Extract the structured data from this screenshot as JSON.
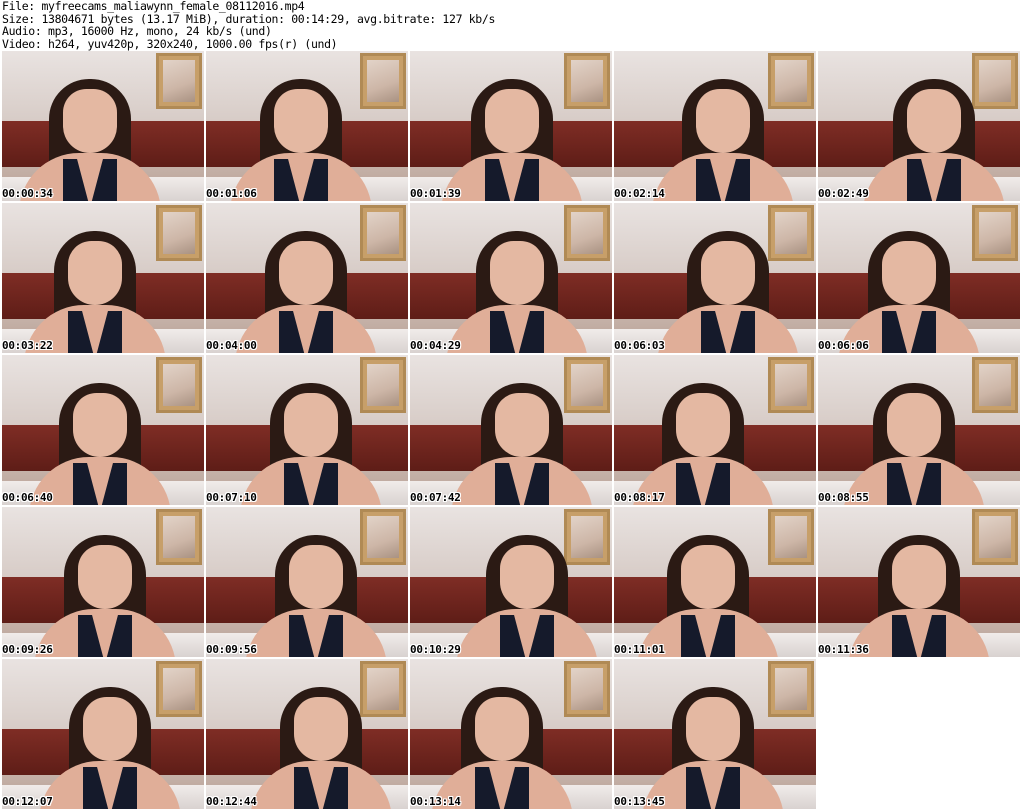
{
  "header": {
    "file_line": "File: myfreecams_maliawynn_female_08112016.mp4",
    "size_line": "Size: 13804671 bytes (13.17 MiB), duration: 00:14:29, avg.bitrate: 127 kb/s",
    "audio_line": "Audio: mp3, 16000 Hz, mono, 24 kb/s (und)",
    "video_line": "Video: h264, yuv420p, 320x240, 1000.00 fps(r) (und)"
  },
  "thumbnails": [
    {
      "timestamp": "00:00:34"
    },
    {
      "timestamp": "00:01:06"
    },
    {
      "timestamp": "00:01:39"
    },
    {
      "timestamp": "00:02:14"
    },
    {
      "timestamp": "00:02:49"
    },
    {
      "timestamp": "00:03:22"
    },
    {
      "timestamp": "00:04:00"
    },
    {
      "timestamp": "00:04:29"
    },
    {
      "timestamp": "00:06:03"
    },
    {
      "timestamp": "00:06:06"
    },
    {
      "timestamp": "00:06:40"
    },
    {
      "timestamp": "00:07:10"
    },
    {
      "timestamp": "00:07:42"
    },
    {
      "timestamp": "00:08:17"
    },
    {
      "timestamp": "00:08:55"
    },
    {
      "timestamp": "00:09:26"
    },
    {
      "timestamp": "00:09:56"
    },
    {
      "timestamp": "00:10:29"
    },
    {
      "timestamp": "00:11:01"
    },
    {
      "timestamp": "00:11:36"
    },
    {
      "timestamp": "00:12:07"
    },
    {
      "timestamp": "00:12:44"
    },
    {
      "timestamp": "00:13:14"
    },
    {
      "timestamp": "00:13:45"
    }
  ]
}
